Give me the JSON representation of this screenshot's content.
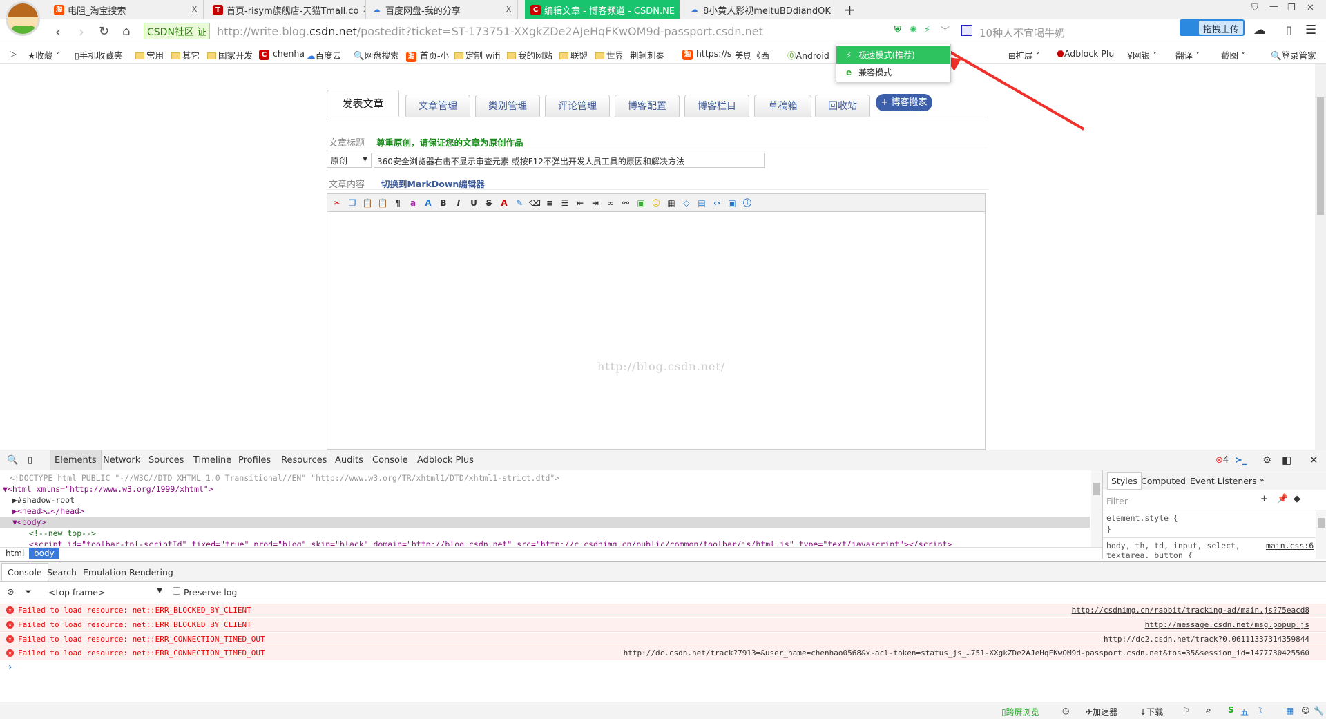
{
  "browser": {
    "tabs": [
      {
        "title": "电阻_淘宝搜索",
        "icon": "taobao-icon",
        "color": "#ff5000"
      },
      {
        "title": "首页-risym旗舰店-天猫Tmall.co",
        "icon": "tmall-icon",
        "color": "#c40000"
      },
      {
        "title": "百度网盘-我的分享",
        "icon": "baidu-cloud-icon",
        "color": "#2d7be5"
      },
      {
        "title": "编辑文章 - 博客频道 - CSDN.NE",
        "icon": "csdn-icon",
        "color": "#c00"
      },
      {
        "title": "8小黄人影视meituBDdiandOK.",
        "icon": "baidu-cloud-icon",
        "color": "#2d7be5"
      }
    ],
    "close_glyph": "X",
    "new_tab": "+",
    "site_badge": "CSDN社区 证",
    "url_prefix": "http://write.blog.",
    "url_domain": "csdn.net",
    "url_rest": "/postedit?ticket=ST-173751-XXgkZDe2AJeHqFKwOM9d-passport.csdn.net",
    "search_hint": "10种人不宜喝牛奶",
    "upload_label": "拖拽上传",
    "bookmarks": [
      "收藏",
      "手机收藏夹",
      "常用",
      "其它",
      "国家开发",
      "chenha",
      "百度云",
      "网盘搜索",
      "首页-小",
      "定制 wifi",
      "我的网站",
      "联盟",
      "世界",
      "荆轲刺秦",
      "https://s",
      "美剧《西",
      "Android"
    ],
    "extensions": [
      "扩展",
      "Adblock Plu",
      "网银",
      "翻译",
      "截图",
      "登录管家"
    ],
    "mode_menu": {
      "fast": "极速模式(推荐)",
      "compat": "兼容模式"
    }
  },
  "page": {
    "tabs": [
      "发表文章",
      "文章管理",
      "类别管理",
      "评论管理",
      "博客配置",
      "博客栏目",
      "草稿箱",
      "回收站"
    ],
    "move_button": "+ 博客搬家",
    "title_label": "文章标题",
    "title_notice": "尊重原创，请保证您的文章为原创作品",
    "type_select": "原创",
    "title_value": "360安全浏览器右击不显示审查元素 或按F12不弹出开发人员工具的原因和解决方法",
    "content_label": "文章内容",
    "markdown_link": "切换到MarkDown编辑器",
    "watermark": "http://blog.csdn.net/"
  },
  "devtools": {
    "tabs": [
      "Elements",
      "Network",
      "Sources",
      "Timeline",
      "Profiles",
      "Resources",
      "Audits",
      "Console",
      "Adblock Plus"
    ],
    "error_count": "4",
    "dom": {
      "doctype": "<!DOCTYPE html PUBLIC \"-//W3C//DTD XHTML 1.0 Transitional//EN\" \"http://www.w3.org/TR/xhtml1/DTD/xhtml1-strict.dtd\">",
      "html": "<html xmlns=\"http://www.w3.org/1999/xhtml\">",
      "shadow": "#shadow-root",
      "head": "<head>…</head>",
      "body": "<body>",
      "comment": "<!--new top-->",
      "script": "<script id=\"toolbar-tpl-scriptId\" fixed=\"true\" prod=\"blog\" skin=\"black\" domain=\"http://blog.csdn.net\" src=\"http://c.csdnimg.cn/public/common/toolbar/js/html.js\" type=\"text/javascript\"></script>"
    },
    "crumbs": [
      "html",
      "body"
    ],
    "side_tabs": [
      "Styles",
      "Computed",
      "Event Listeners",
      "»"
    ],
    "filter_placeholder": "Filter",
    "styles": {
      "rule1": "element.style {",
      "close": "}",
      "rule2": "body, th, td, input, select,",
      "rule2b": "textarea, button {",
      "source": "main.css:6"
    },
    "drawer_tabs": [
      "Console",
      "Search",
      "Emulation",
      "Rendering"
    ],
    "frame": "<top frame>",
    "preserve": "Preserve log",
    "errors": [
      {
        "msg": "Failed to load resource: net::ERR_BLOCKED_BY_CLIENT",
        "url": "http://csdnimg.cn/rabbit/tracking-ad/main.js?75eacd8"
      },
      {
        "msg": "Failed to load resource: net::ERR_BLOCKED_BY_CLIENT",
        "url": "http://message.csdn.net/msg.popup.js"
      },
      {
        "msg": "Failed to load resource: net::ERR_CONNECTION_TIMED_OUT",
        "url": "http://dc2.csdn.net/track?0.06111337314359844"
      },
      {
        "msg": "Failed to load resource: net::ERR_CONNECTION_TIMED_OUT",
        "url": "http://dc.csdn.net/track?7913=&user_name=chenhao0568&x-acl-token=status_js_…751-XXgkZDe2AJeHqFKwOM9d-passport.csdn.net&tos=35&session_id=1477730425560"
      }
    ],
    "prompt": "›"
  },
  "statusbar": {
    "items": [
      "跨屏浏览",
      "加速器",
      "下载"
    ]
  }
}
